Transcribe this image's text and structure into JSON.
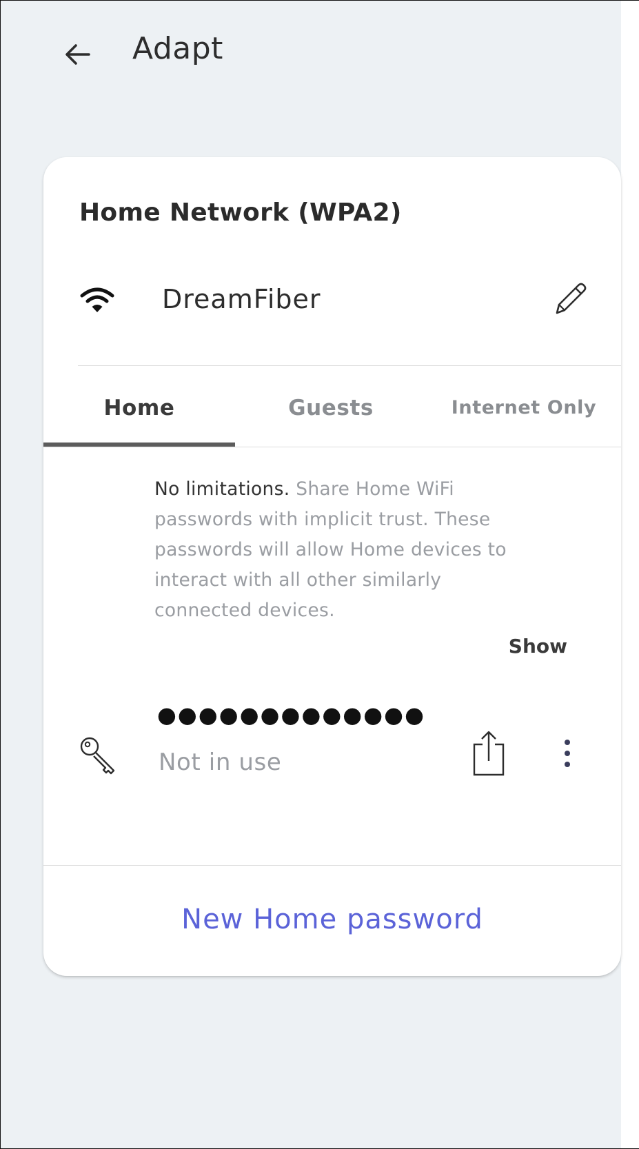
{
  "header": {
    "title": "Adapt",
    "back_icon": "arrow-left-icon"
  },
  "network": {
    "title": "Home Network (WPA2)",
    "ssid": "DreamFiber",
    "wifi_icon": "wifi-icon",
    "edit_icon": "pencil-icon"
  },
  "tabs": [
    {
      "label": "Home",
      "active": true
    },
    {
      "label": "Guests",
      "active": false
    },
    {
      "label": "Internet Only",
      "active": false
    }
  ],
  "description": {
    "lead": "No limitations.",
    "body": " Share Home WiFi passwords with implicit trust. These passwords will allow Home devices to interact with all other similarly connected devices."
  },
  "password": {
    "show_label": "Show",
    "masked": "●●●●●●●●●●●●●",
    "status": "Not in use",
    "key_icon": "key-icon",
    "share_icon": "share-icon",
    "more_icon": "more-vertical-icon"
  },
  "actions": {
    "new_password": "New Home password"
  },
  "colors": {
    "background": "#edf1f4",
    "card": "#ffffff",
    "accent": "#5b63d8",
    "muted_text": "#9a9da2",
    "primary_text": "#2d2d2d"
  }
}
